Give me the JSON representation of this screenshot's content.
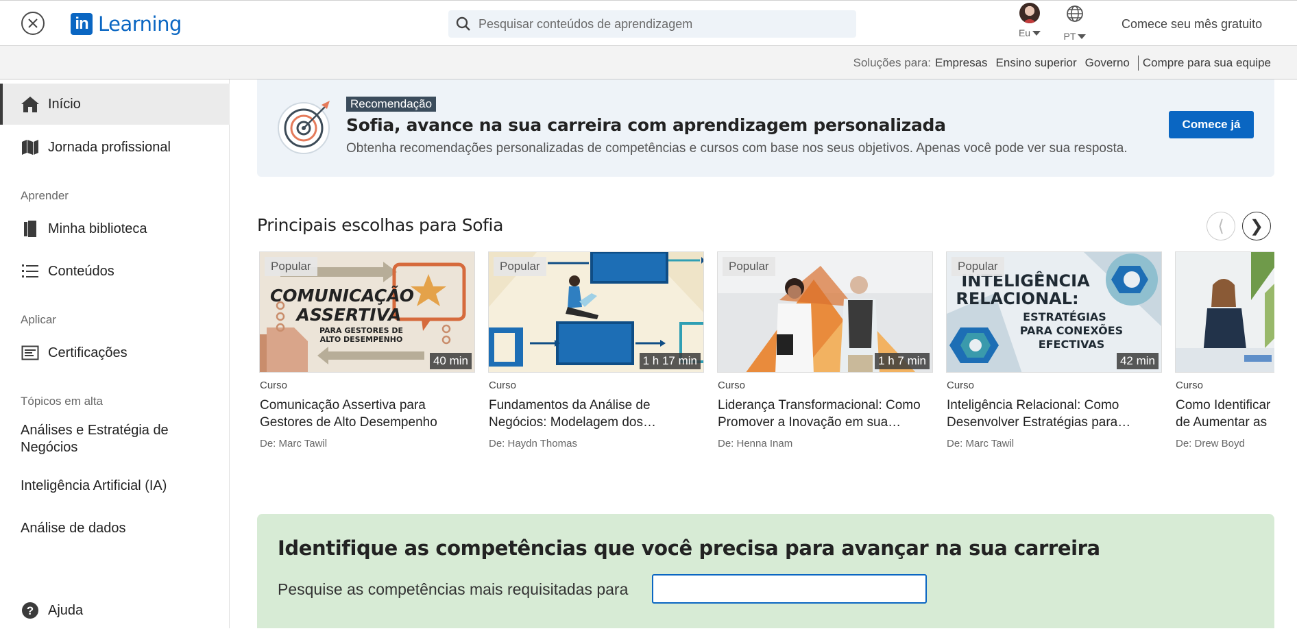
{
  "header": {
    "logo_in": "in",
    "logo_text": "Learning",
    "search_placeholder": "Pesquisar conteúdos de aprendizagem",
    "me_label": "Eu",
    "lang_label": "PT",
    "free_month": "Comece seu mês gratuito"
  },
  "solutions": {
    "label": "Soluções para:",
    "links": [
      "Empresas",
      "Ensino superior",
      "Governo",
      "Compre para sua equipe"
    ]
  },
  "sidebar": {
    "items": [
      {
        "label": "Início",
        "icon": "home-icon"
      },
      {
        "label": "Jornada profissional",
        "icon": "map-icon"
      },
      {
        "label": "Minha biblioteca",
        "icon": "library-icon"
      },
      {
        "label": "Conteúdos",
        "icon": "list-icon"
      },
      {
        "label": "Certificações",
        "icon": "certificate-icon"
      },
      {
        "label": "Ajuda",
        "icon": "help-icon"
      }
    ],
    "sections": {
      "learn": "Aprender",
      "apply": "Aplicar",
      "trending": "Tópicos em alta"
    },
    "topics": [
      "Análises e Estratégia de Negócios",
      "Inteligência Artificial (IA)",
      "Análise de dados"
    ]
  },
  "recommendation": {
    "badge": "Recomendação",
    "title": "Sofia, avance na sua carreira com aprendizagem personalizada",
    "description": "Obtenha recomendações personalizadas de competências e cursos com base nos seus objetivos. Apenas você pode ver sua resposta.",
    "button": "Comece já"
  },
  "picks": {
    "title": "Principais escolhas para Sofia",
    "cards": [
      {
        "badge": "Popular",
        "duration": "40 min",
        "type": "Curso",
        "title": "Comunicação Assertiva para Gestores de Alto Desempenho",
        "author": "De: Marc Tawil",
        "thumb_lines": [
          "COMUNICAÇÃO",
          "ASSERTIVA",
          "PARA GESTORES DE",
          "ALTO DESEMPENHO"
        ]
      },
      {
        "badge": "Popular",
        "duration": "1 h 17 min",
        "type": "Curso",
        "title": "Fundamentos da Análise de Negócios: Modelagem dos…",
        "author": "De: Haydn Thomas"
      },
      {
        "badge": "Popular",
        "duration": "1 h 7 min",
        "type": "Curso",
        "title": "Liderança Transformacional: Como Promover a Inovação em sua…",
        "author": "De: Henna Inam"
      },
      {
        "badge": "Popular",
        "duration": "42 min",
        "type": "Curso",
        "title": "Inteligência Relacional: Como Desenvolver Estratégias para…",
        "author": "De: Marc Tawil",
        "thumb_lines": [
          "INTELIGÊNCIA",
          "RELACIONAL:",
          "ESTRATÉGIAS",
          "PARA CONEXÕES",
          "EFECTIVAS"
        ]
      },
      {
        "badge": "",
        "duration": "",
        "type": "Curso",
        "title": "Como Identificar de Aumentar as",
        "author": "De: Drew Boyd"
      }
    ]
  },
  "skills": {
    "title": "Identifique as competências que você precisa para avançar na sua carreira",
    "label": "Pesquise as competências mais requisitadas para",
    "input_value": ""
  },
  "colors": {
    "brand": "#0a66c2",
    "reco_bg": "#eef3f8",
    "skills_bg": "#d7ebd5"
  }
}
